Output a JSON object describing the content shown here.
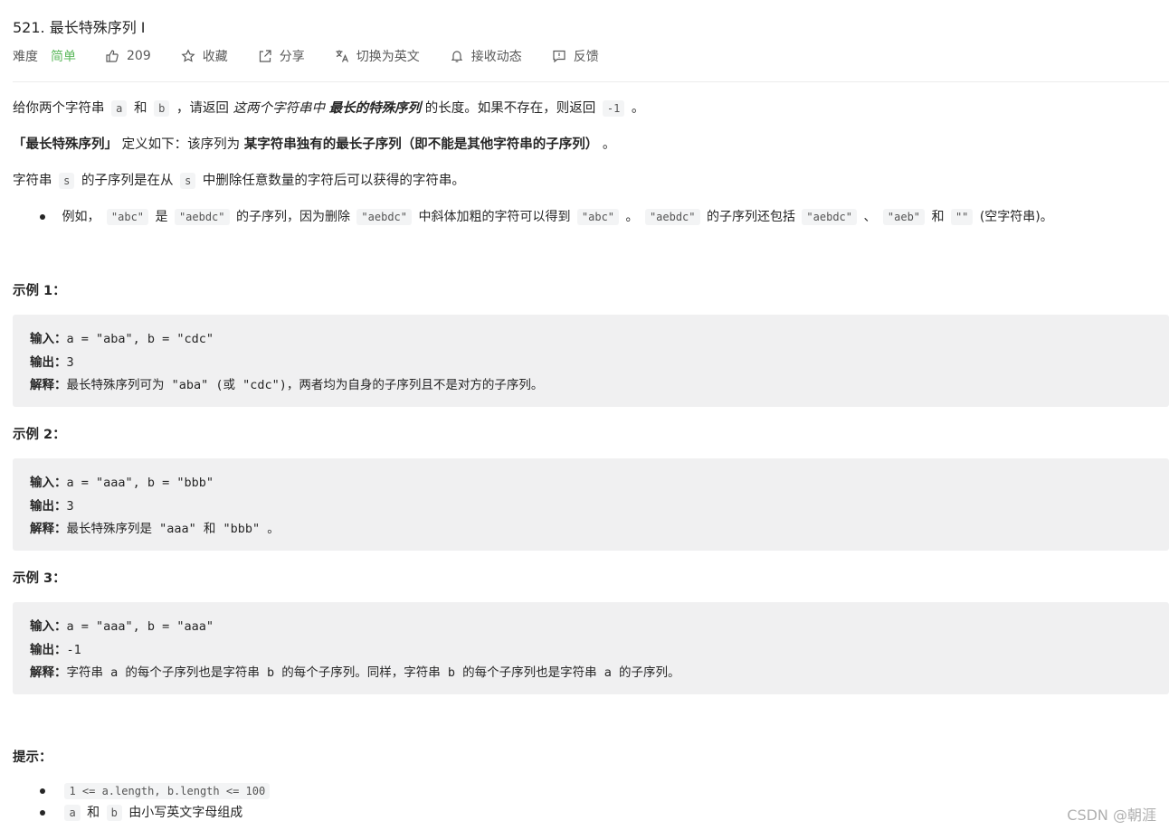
{
  "problem": {
    "title": "521. 最长特殊序列 Ⅰ",
    "difficulty_label": "难度",
    "difficulty": "简单",
    "likes": "209",
    "favorite": "收藏",
    "share": "分享",
    "translate": "切换为英文",
    "notify": "接收动态",
    "feedback": "反馈"
  },
  "desc": {
    "p1": {
      "t1": "给你两个字符串",
      "c1": "a",
      "t2": "和",
      "c2": "b",
      "t3": "，请返回",
      "em1": "这两个字符串中",
      "em2": "最长的特殊序列",
      "t4": "的长度。如果不存在，则返回",
      "c3": "-1",
      "t5": "。"
    },
    "p2": {
      "b1": "「最长特殊序列」",
      "t1": "定义如下：该序列为",
      "b2": "某字符串独有的最长子序列（即不能是其他字符串的子序列）",
      "t2": "。"
    },
    "p3": {
      "t1": "字符串",
      "c1": "s",
      "t2": "的子序列是在从",
      "c2": "s",
      "t3": "中删除任意数量的字符后可以获得的字符串。"
    },
    "bullet": {
      "t1": "例如，",
      "c1": "\"abc\"",
      "t2": "是",
      "c2": "\"aebdc\"",
      "t3": "的子序列，因为删除",
      "c3": "\"aebdc\"",
      "t4": "中斜体加粗的字符可以得到",
      "c4": "\"abc\"",
      "t5": "。",
      "c5": "\"aebdc\"",
      "t6": "的子序列还包括",
      "c6": "\"aebdc\"",
      "t7": "、",
      "c7": "\"aeb\"",
      "t8": "和",
      "c8": "\"\"",
      "t9": "(空字符串)。"
    }
  },
  "examples": [
    {
      "heading": "示例 1：",
      "in_label": "输入：",
      "input": "a = \"aba\", b = \"cdc\"",
      "out_label": "输出：",
      "output": "3",
      "ex_label": "解释：",
      "explain": "最长特殊序列可为 \"aba\" (或 \"cdc\")，两者均为自身的子序列且不是对方的子序列。"
    },
    {
      "heading": "示例 2：",
      "in_label": "输入：",
      "input": "a = \"aaa\", b = \"bbb\"",
      "out_label": "输出：",
      "output": "3",
      "ex_label": "解释：",
      "explain": "最长特殊序列是 \"aaa\" 和 \"bbb\" 。"
    },
    {
      "heading": "示例 3：",
      "in_label": "输入：",
      "input": "a = \"aaa\", b = \"aaa\"",
      "out_label": "输出：",
      "output": "-1",
      "ex_label": "解释：",
      "explain": "字符串 a 的每个子序列也是字符串 b 的每个子序列。同样，字符串 b 的每个子序列也是字符串 a 的子序列。"
    }
  ],
  "hints": {
    "heading": "提示：",
    "h1_code": "1 <= a.length, b.length <= 100",
    "h2_c1": "a",
    "h2_t1": "和",
    "h2_c2": "b",
    "h2_t2": "由小写英文字母组成"
  },
  "watermark": "CSDN @朝涯",
  "colors": {
    "difficulty": "#5cb85c",
    "code_bg": "#f3f4f5",
    "example_bg": "#f0f0f1"
  }
}
